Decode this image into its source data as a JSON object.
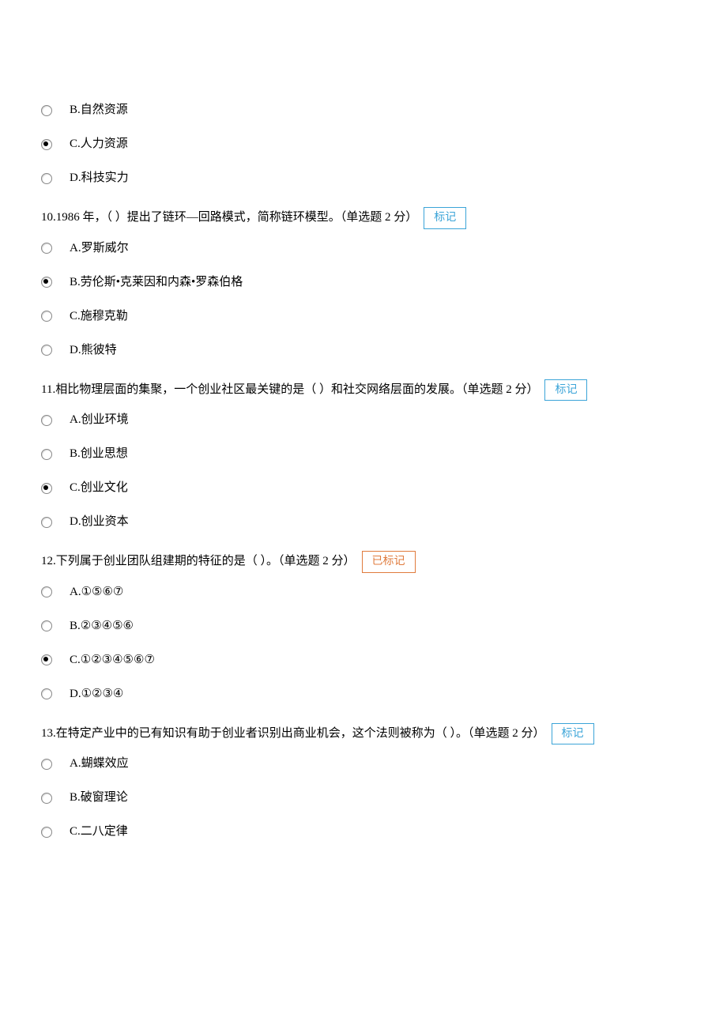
{
  "mark_label": "标记",
  "marked_label": "已标记",
  "q9_tail_options": [
    {
      "label": "B.自然资源",
      "selected": false
    },
    {
      "label": "C.人力资源",
      "selected": true
    },
    {
      "label": "D.科技实力",
      "selected": false
    }
  ],
  "questions": [
    {
      "text": "10.1986 年，（ ）提出了链环—回路模式，简称链环模型。（单选题 2 分）",
      "marked": false,
      "options": [
        {
          "label": "A.罗斯威尔",
          "selected": false
        },
        {
          "label": "B.劳伦斯•克莱因和内森•罗森伯格",
          "selected": true
        },
        {
          "label": "C.施穆克勒",
          "selected": false
        },
        {
          "label": "D.熊彼特",
          "selected": false
        }
      ]
    },
    {
      "text": "11.相比物理层面的集聚，一个创业社区最关键的是（ ）和社交网络层面的发展。（单选题 2 分）",
      "marked": false,
      "options": [
        {
          "label": "A.创业环境",
          "selected": false
        },
        {
          "label": "B.创业思想",
          "selected": false
        },
        {
          "label": "C.创业文化",
          "selected": true
        },
        {
          "label": "D.创业资本",
          "selected": false
        }
      ]
    },
    {
      "text": "12.下列属于创业团队组建期的特征的是（ ）。（单选题 2 分）",
      "marked": true,
      "options": [
        {
          "label": "A.①⑤⑥⑦",
          "selected": false
        },
        {
          "label": "B.②③④⑤⑥",
          "selected": false
        },
        {
          "label": "C.①②③④⑤⑥⑦",
          "selected": true
        },
        {
          "label": "D.①②③④",
          "selected": false
        }
      ]
    },
    {
      "text": "13.在特定产业中的已有知识有助于创业者识别出商业机会，这个法则被称为（ ）。（单选题 2 分）",
      "marked": false,
      "options": [
        {
          "label": "A.蝴蝶效应",
          "selected": false
        },
        {
          "label": "B.破窗理论",
          "selected": false
        },
        {
          "label": "C.二八定律",
          "selected": false
        }
      ]
    }
  ]
}
